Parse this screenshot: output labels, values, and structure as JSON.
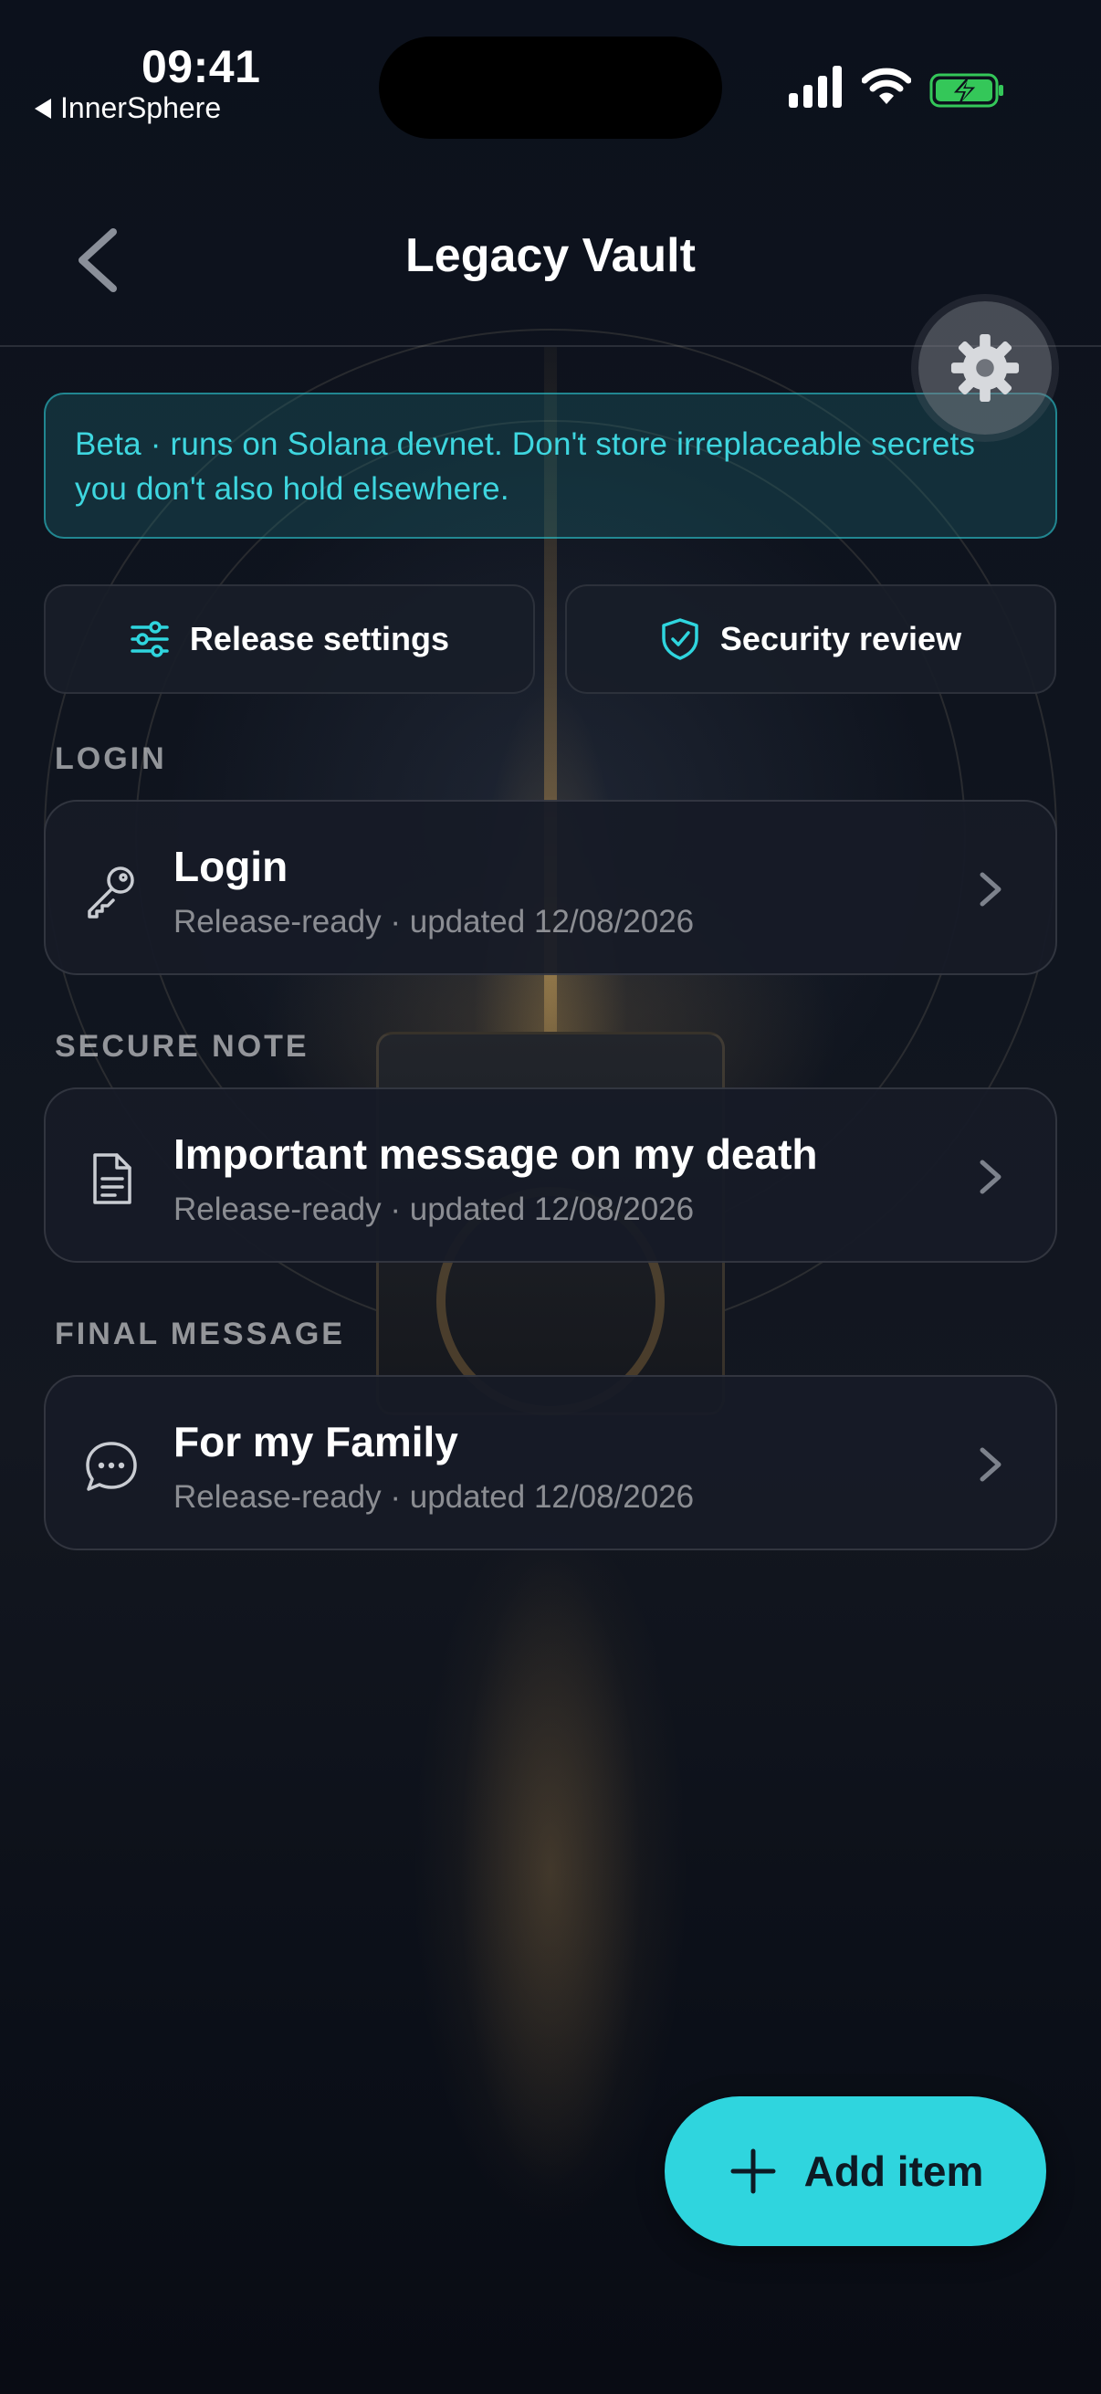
{
  "status_bar": {
    "time": "09:41",
    "back_app": "InnerSphere"
  },
  "nav": {
    "title": "Legacy Vault",
    "back_icon": "chevron-left-icon",
    "settings_icon": "gear-icon"
  },
  "banner": {
    "text": "Beta · runs on Solana devnet. Don't store irreplaceable secrets you don't also hold elsewhere."
  },
  "actions": {
    "release_settings": {
      "label": "Release settings",
      "icon": "sliders-icon"
    },
    "security_review": {
      "label": "Security review",
      "icon": "shield-check-icon"
    }
  },
  "sections": [
    {
      "header": "LOGIN",
      "items": [
        {
          "title": "Login",
          "subtitle": "Release-ready · updated 12/08/2026",
          "icon": "key-icon"
        }
      ]
    },
    {
      "header": "SECURE NOTE",
      "items": [
        {
          "title": "Important message on my death",
          "subtitle": "Release-ready · updated 12/08/2026",
          "icon": "document-icon"
        }
      ]
    },
    {
      "header": "FINAL MESSAGE",
      "items": [
        {
          "title": "For my Family",
          "subtitle": "Release-ready · updated 12/08/2026",
          "icon": "chat-bubble-icon"
        }
      ]
    }
  ],
  "fab": {
    "label": "Add item",
    "icon": "plus-icon"
  },
  "colors": {
    "accent": "#2fd5de",
    "background": "#0d111b",
    "card": "#161b26",
    "battery": "#34c759"
  }
}
